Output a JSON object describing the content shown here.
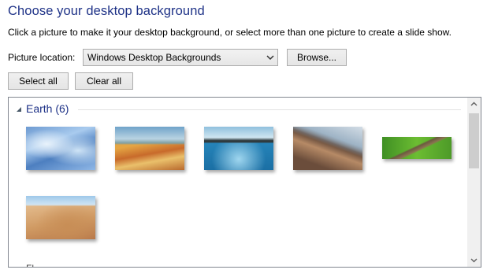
{
  "header": {
    "title": "Choose your desktop background",
    "subtitle": "Click a picture to make it your desktop background, or select more than one picture to create a slide show."
  },
  "location": {
    "label": "Picture location:",
    "selected": "Windows Desktop Backgrounds",
    "browse_label": "Browse..."
  },
  "actions": {
    "select_all": "Select all",
    "clear_all": "Clear all"
  },
  "gallery": {
    "group_title": "Earth (6)",
    "next_group_partial": "Fl",
    "thumbnails": [
      {
        "name": "earth-ice"
      },
      {
        "name": "earth-desert-hills"
      },
      {
        "name": "earth-seascape"
      },
      {
        "name": "earth-rock-shore"
      },
      {
        "name": "earth-green-field"
      },
      {
        "name": "earth-sand-dunes"
      }
    ]
  },
  "colors": {
    "title": "#1e3287",
    "border": "#828790"
  },
  "icons": [
    "chevron-down-icon",
    "collapse-triangle-icon",
    "scroll-up-icon",
    "scroll-down-icon"
  ]
}
